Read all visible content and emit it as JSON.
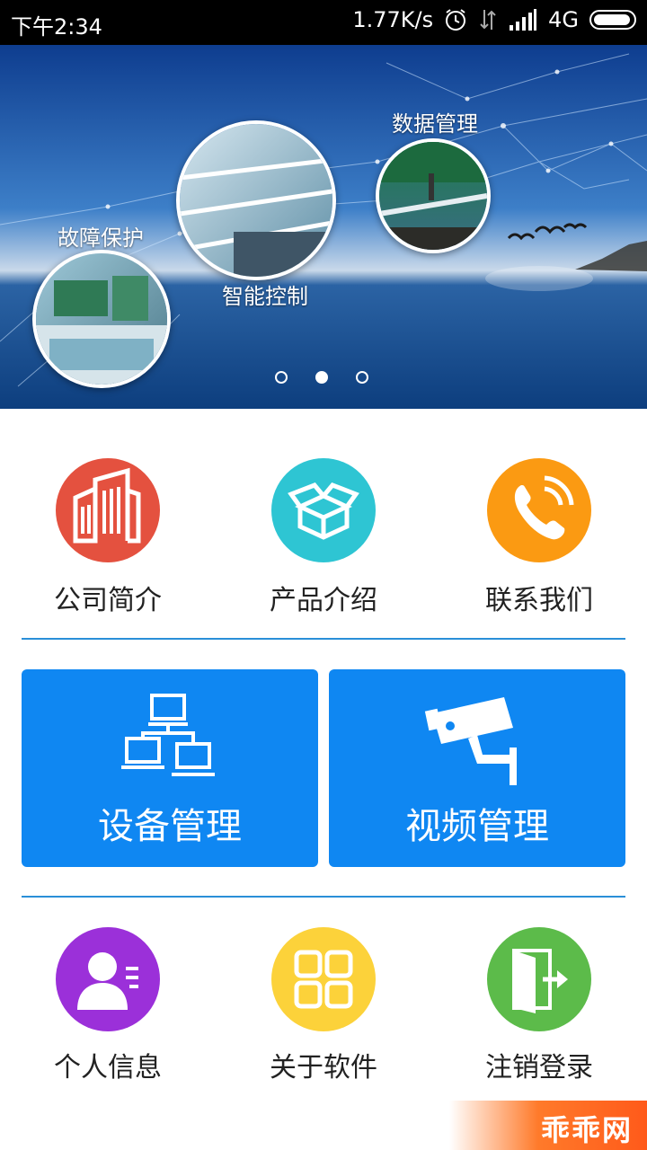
{
  "status_bar": {
    "time": "下午2:34",
    "speed": "1.77K/s",
    "network": "4G"
  },
  "banner": {
    "labels": {
      "fault": "故障保护",
      "smart": "智能控制",
      "data": "数据管理"
    },
    "page_count": 3,
    "active_page": 2
  },
  "top_menu": [
    {
      "label": "公司简介",
      "icon": "building-icon",
      "color": "#e4513f"
    },
    {
      "label": "产品介绍",
      "icon": "box-icon",
      "color": "#2ec5d3"
    },
    {
      "label": "联系我们",
      "icon": "phone-icon",
      "color": "#fb9a12"
    }
  ],
  "cards": [
    {
      "label": "设备管理",
      "icon": "network-computers-icon"
    },
    {
      "label": "视频管理",
      "icon": "security-camera-icon"
    }
  ],
  "bottom_menu": [
    {
      "label": "个人信息",
      "icon": "user-profile-icon",
      "color": "#9b30d9"
    },
    {
      "label": "关于软件",
      "icon": "apps-grid-icon",
      "color": "#fcd23a"
    },
    {
      "label": "注销登录",
      "icon": "logout-door-icon",
      "color": "#5cbb4a"
    }
  ],
  "watermark": "乖乖网",
  "colors": {
    "accent_blue": "#0f87f2",
    "divider": "#2a8fd8"
  }
}
